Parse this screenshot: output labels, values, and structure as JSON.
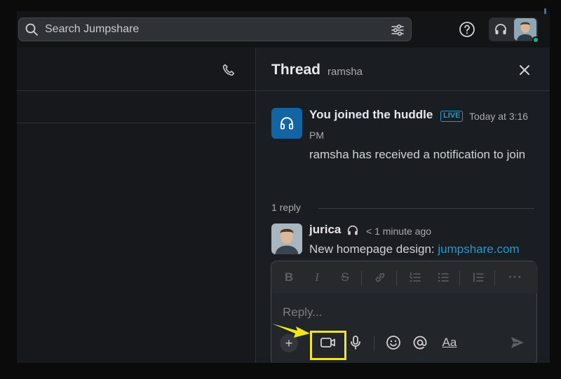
{
  "search": {
    "placeholder": "Search Jumpshare"
  },
  "thread": {
    "title": "Thread",
    "channel": "ramsha",
    "message1": {
      "title": "You joined the huddle",
      "badge": "LIVE",
      "time_part1": "Today at 3:16",
      "time_part2": "PM",
      "body": "ramsha has received a notification to join"
    },
    "reply_count": "1 reply",
    "message2": {
      "author": "jurica",
      "time": "< 1 minute ago",
      "text_prefix": "New homepage design: ",
      "link": "jumpshare.com"
    }
  },
  "composer": {
    "placeholder": "Reply...",
    "format_aa": "Aa"
  },
  "icons": {
    "search": "search-icon",
    "filter": "sliders-icon",
    "help": "help-circle-icon",
    "headphones": "headphones-icon",
    "phone": "phone-icon",
    "close": "close-icon",
    "video": "video-camera-icon",
    "mic": "microphone-icon",
    "emoji": "smiley-icon",
    "mention": "at-icon",
    "send": "send-icon"
  },
  "colors": {
    "accent_link": "#1d9bd1",
    "huddle_tile": "#1264a3",
    "highlight": "#f2e51d",
    "online": "#2bac76"
  }
}
